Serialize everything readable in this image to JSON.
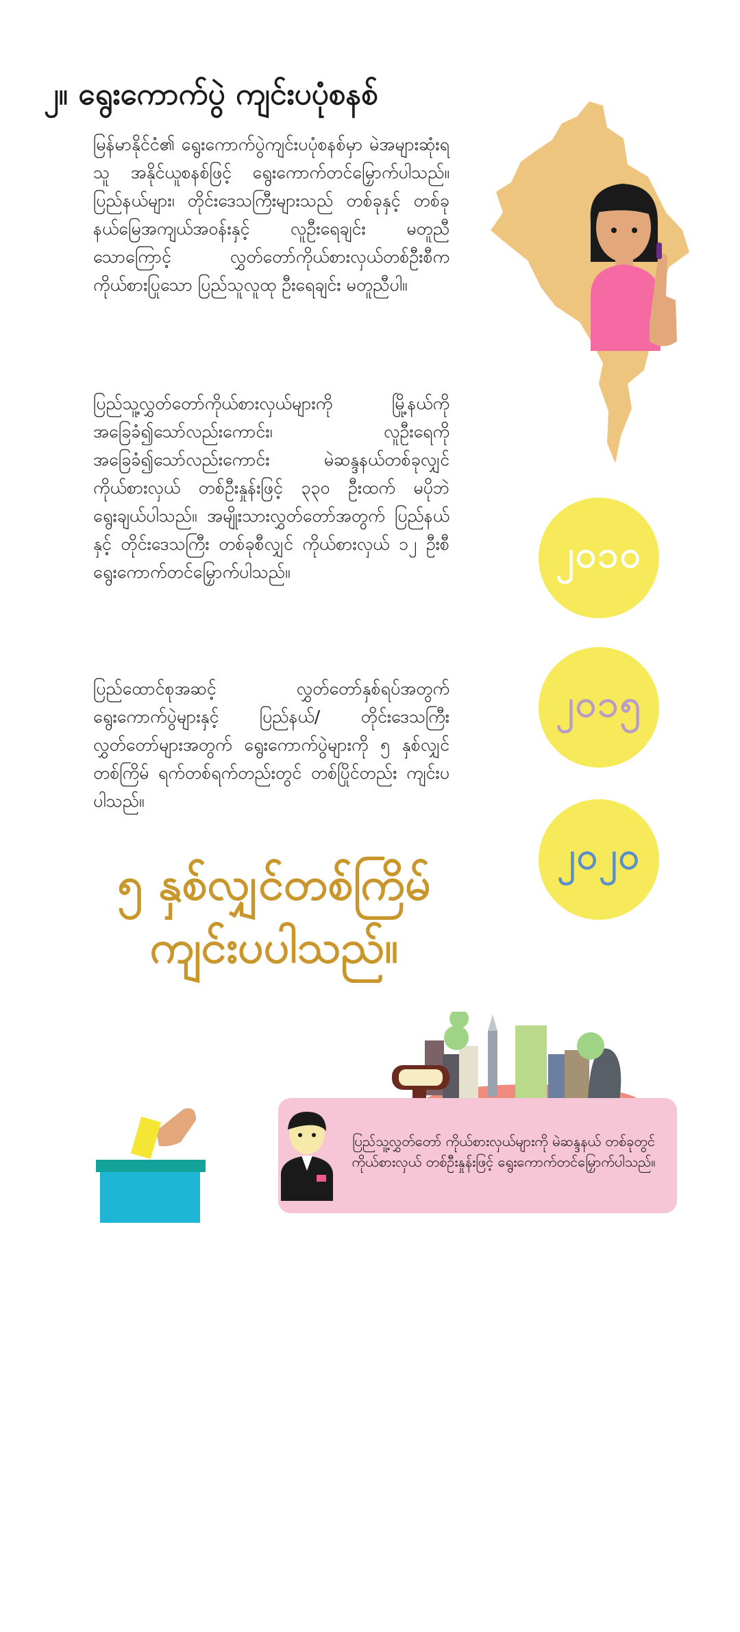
{
  "heading": "၂။ ရွေးကောက်ပွဲ ကျင်းပပုံစနစ်",
  "paragraphs": [
    "မြန်မာနိုင်ငံ၏ ရွေးကောက်ပွဲကျင်းပပုံစနစ်မှာ မဲအများဆုံးရသူ အနိုင်ယူစနစ်ဖြင့် ရွေးကောက်တင်မြှောက်ပါသည်။ ပြည်နယ်များ၊ တိုင်းဒေသကြီးများသည် တစ်ခုနှင့် တစ်ခု နယ်မြေအကျယ်အဝန်းနှင့် လူဦးရေချင်း မတူညီသောကြောင့် လွှတ်တော်ကိုယ်စားလှယ်တစ်ဦးစီက ကိုယ်စားပြုသော ပြည်သူလူထု ဦးရေချင်း မတူညီပါ။",
    "ပြည်သူ့လွှတ်တော်ကိုယ်စားလှယ်များကို မြို့နယ်ကိုအခြေခံ၍သော်လည်းကောင်း၊ လူဦးရေကိုအခြေခံ၍သော်လည်းကောင်း မဲဆန္ဒနယ်တစ်ခုလျှင် ကိုယ်စားလှယ် တစ်ဦးနှုန်းဖြင့် ၃၃၀ ဦးထက် မပိုဘဲရွေးချယ်ပါသည်။ အမျိုးသားလွှတ်တော်အတွက် ပြည်နယ်နှင့် တိုင်းဒေသကြီး တစ်ခုစီလျှင် ကိုယ်စားလှယ် ၁၂ ဦးစီ ရွေးကောက်တင်မြှောက်ပါသည်။",
    "ပြည်ထောင်စုအဆင့် လွှတ်တော်နှစ်ရပ်အတွက် ရွေးကောက်ပွဲများနှင့် ပြည်နယ်/ တိုင်းဒေသကြီး လွှတ်တော်များအတွက် ရွေးကောက်ပွဲများကို ၅ နှစ်လျှင် တစ်ကြိမ် ရက်တစ်ရက်တည်းတွင် တစ်ပြိုင်တည်း ကျင်းပပါသည်။"
  ],
  "highlight": [
    "၅ နှစ်လျှင်တစ်ကြိမ်",
    "ကျင်းပပါသည်။"
  ],
  "years": [
    {
      "label": "၂၀၁၀",
      "color": "#ffffff"
    },
    {
      "label": "၂၀၁၅",
      "color": "#b89bc7"
    },
    {
      "label": "၂၀၂၀",
      "color": "#5b8fc9"
    }
  ],
  "callout": "ပြည်သူ့လွှတ်တော် ကိုယ်စားလှယ်များကို မဲဆန္ဒနယ် တစ်ခုတွင် ကိုယ်စားလှယ် တစ်ဦးနှုန်းဖြင့် ရွေးကောက်တင်မြှောက်ပါသည်။",
  "colors": {
    "circle": "#f7ea5a",
    "highlight": "#c9962c",
    "map": "#eec57e",
    "callout": "#f7c6d6",
    "ballot_box": "#1fb5d6",
    "ballot_lid": "#14a39a"
  },
  "icons": [
    "myanmar-map-icon",
    "voter-woman-icon",
    "ballot-box-icon",
    "city-icon",
    "representative-icon"
  ]
}
